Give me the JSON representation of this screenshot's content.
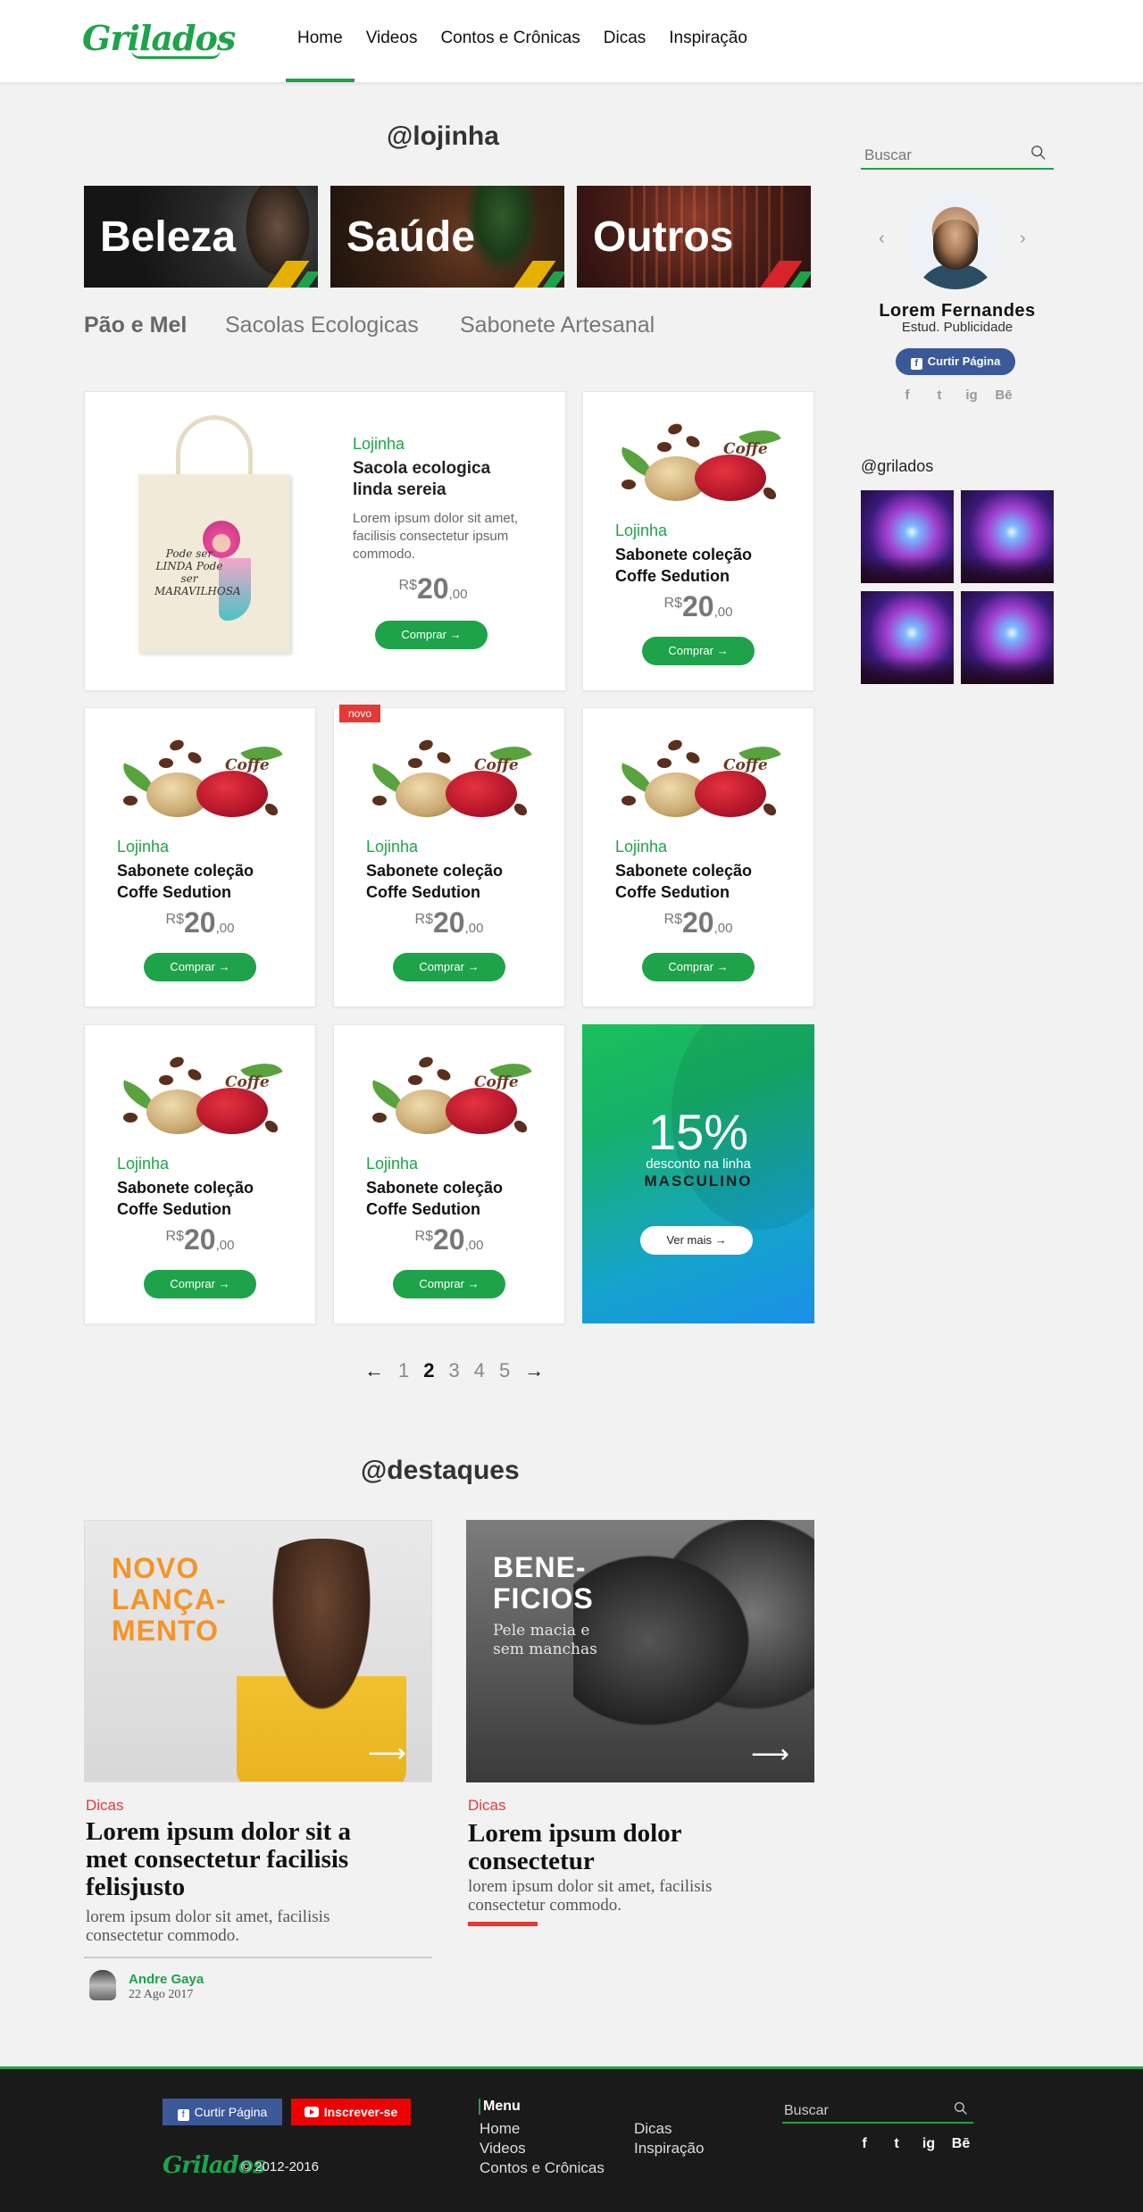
{
  "header": {
    "logo": "Grilados",
    "nav": [
      "Home",
      "Videos",
      "Contos e Crônicas",
      "Dicas",
      "Inspiração"
    ]
  },
  "lojinha": {
    "title": "@lojinha",
    "categories": [
      "Beleza",
      "Saúde",
      "Outros"
    ],
    "subtabs": [
      "Pão e Mel",
      "Sacolas Ecologicas",
      "Sabonete Artesanal"
    ],
    "featured": {
      "category": "Lojinha",
      "name": "Sacola ecologica linda sereia",
      "description": "Lorem ipsum dolor sit amet, facilisis consectetur ipsum commodo.",
      "bag_text": "Pode ser LINDA Pode ser MARAVILHOSA",
      "currency": "R$",
      "price_int": "20",
      "price_dec": ",00",
      "button": "Comprar →"
    },
    "product": {
      "category": "Lojinha",
      "name": "Sabonete coleção Coffe Sedution",
      "coffe_text": "Coffe",
      "currency": "R$",
      "price_int": "20",
      "price_dec": ",00",
      "button": "Comprar →"
    },
    "badge_new": "novo",
    "promo": {
      "percent": "15%",
      "line1": "desconto na linha",
      "line2": "MASCULINO",
      "button": "Ver mais →"
    },
    "pagination": {
      "prev": "←",
      "pages": [
        "1",
        "2",
        "3",
        "4",
        "5"
      ],
      "current": "2",
      "next": "→"
    }
  },
  "destaques": {
    "title": "@destaques",
    "items": [
      {
        "overlay_title": "NOVO LANÇA- MENTO",
        "tag": "Dicas",
        "title": "Lorem ipsum dolor sit a met consectetur facilisis felisjusto",
        "description": "lorem ipsum dolor sit amet, facilisis consectetur commodo.",
        "author": "Andre Gaya",
        "date": "22 Ago 2017"
      },
      {
        "overlay_title": "BENE- FICIOS",
        "overlay_sub": "Pele macia e sem manchas",
        "tag": "Dicas",
        "title": "Lorem ipsum dolor consectetur",
        "description": "lorem ipsum dolor sit amet, facilisis consectetur commodo."
      }
    ]
  },
  "sidebar": {
    "search_placeholder": "Buscar",
    "profile_name": "Lorem Fernandes",
    "profile_role": "Estud. Publicidade",
    "like_button": "Curtir Página",
    "social": [
      "f",
      "t",
      "ig",
      "Bē"
    ],
    "instagram_title": "@grilados"
  },
  "footer": {
    "like_button": "Curtir Página",
    "subscribe_button": "Inscrever-se",
    "logo": "Grilados",
    "copyright": "© 2012-2016",
    "menu_title": "Menu",
    "menu_col1": [
      "Home",
      "Videos",
      "Contos e Crônicas"
    ],
    "menu_col2": [
      "Dicas",
      "Inspiração"
    ],
    "search_placeholder": "Buscar",
    "social": [
      "f",
      "t",
      "ig",
      "Bē"
    ]
  },
  "colors": {
    "brand_green": "#1ea34a",
    "tag_red": "#e53935",
    "facebook_blue": "#3b5998",
    "youtube_red": "#ee0000"
  }
}
